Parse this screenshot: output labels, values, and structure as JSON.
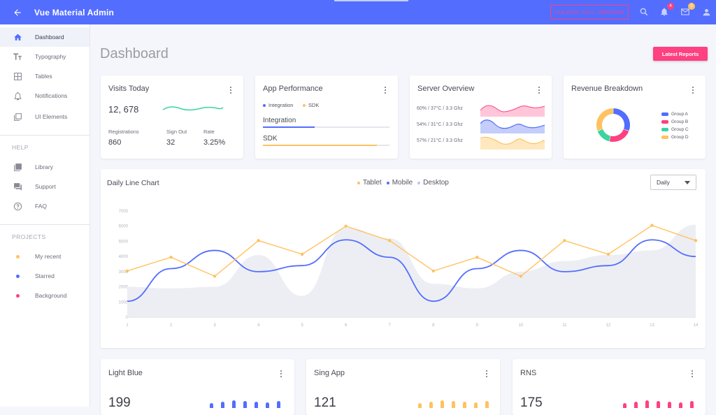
{
  "header": {
    "title": "Vue Material Admin",
    "unlock_label": "Unlock full version",
    "notifications_count": "4",
    "messages_count": "3"
  },
  "sidebar": {
    "items": [
      {
        "label": "Dashboard",
        "icon": "home-icon"
      },
      {
        "label": "Typography",
        "icon": "text-format-icon"
      },
      {
        "label": "Tables",
        "icon": "table-icon"
      },
      {
        "label": "Notifications",
        "icon": "bell-icon"
      },
      {
        "label": "UI Elements",
        "icon": "layers-icon"
      }
    ],
    "help_heading": "HELP",
    "help_items": [
      {
        "label": "Library",
        "icon": "library-icon"
      },
      {
        "label": "Support",
        "icon": "forum-icon"
      },
      {
        "label": "FAQ",
        "icon": "help-circle-icon"
      }
    ],
    "projects_heading": "PROJECTS",
    "projects": [
      {
        "label": "My recent",
        "color": "#ffc260"
      },
      {
        "label": "Starred",
        "color": "#536dfe"
      },
      {
        "label": "Background",
        "color": "#ff4081"
      }
    ]
  },
  "page": {
    "title": "Dashboard",
    "latest_reports_label": "Latest Reports"
  },
  "visits": {
    "title": "Visits Today",
    "value": "12, 678",
    "stats": [
      {
        "label": "Registrations",
        "value": "860"
      },
      {
        "label": "Sign Out",
        "value": "32"
      },
      {
        "label": "Rate",
        "value": "3.25%"
      }
    ]
  },
  "performance": {
    "title": "App Performance",
    "legend": [
      {
        "label": "Integration",
        "color": "#536dfe"
      },
      {
        "label": "SDK",
        "color": "#ffc260"
      }
    ],
    "bars": [
      {
        "label": "Integration",
        "value": 0.41,
        "color": "#536dfe"
      },
      {
        "label": "SDK",
        "value": 0.9,
        "color": "#ffc260"
      }
    ]
  },
  "server": {
    "title": "Server Overview",
    "rows": [
      {
        "label": "60% / 37°C / 3.3 Ghz",
        "color": "#ff4081"
      },
      {
        "label": "54% / 31°C / 3.3 Ghz",
        "color": "#536dfe"
      },
      {
        "label": "57% / 21°C / 3.3 Ghz",
        "color": "#ffc260"
      }
    ]
  },
  "revenue": {
    "title": "Revenue Breakdown",
    "groups": [
      {
        "label": "Group A",
        "color": "#536dfe",
        "value": 400
      },
      {
        "label": "Group B",
        "color": "#ff4081",
        "value": 300
      },
      {
        "label": "Group C",
        "color": "#3cd4a0",
        "value": 200
      },
      {
        "label": "Group D",
        "color": "#ffc260",
        "value": 400
      }
    ]
  },
  "daily_chart": {
    "title": "Daily Line Chart",
    "select_value": "Daily",
    "legend": [
      {
        "label": "Tablet",
        "color": "#ffc260"
      },
      {
        "label": "Mobile",
        "color": "#536dfe"
      },
      {
        "label": "Desktop",
        "color": "#b7c4ff"
      }
    ]
  },
  "chart_data": {
    "type": "line",
    "title": "Daily Line Chart",
    "x": [
      1,
      2,
      3,
      4,
      5,
      6,
      7,
      8,
      9,
      10,
      11,
      12,
      13,
      14
    ],
    "ylim": [
      0,
      7000
    ],
    "yticks": [
      "7000",
      "6000",
      "5000",
      "4000",
      "3000",
      "2000",
      "1000",
      "0"
    ],
    "xticks": [
      "1",
      "2",
      "3",
      "4",
      "5",
      "6",
      "7",
      "8",
      "9",
      "10",
      "11",
      "12",
      "13",
      "14"
    ],
    "series": [
      {
        "name": "Tablet",
        "color": "#ffc260",
        "values": [
          3050,
          3950,
          2700,
          5050,
          4150,
          6000,
          5050,
          3050,
          3950,
          2700,
          5050,
          4150,
          6050,
          5050
        ]
      },
      {
        "name": "Mobile",
        "color": "#536dfe",
        "values": [
          1050,
          3200,
          4400,
          3000,
          3400,
          5100,
          3950,
          1050,
          3200,
          4400,
          3000,
          3400,
          5100,
          4000
        ]
      },
      {
        "name": "Desktop",
        "color": "#eceef3",
        "values": [
          2000,
          1900,
          2000,
          4100,
          1400,
          5900,
          5200,
          2200,
          1900,
          3000,
          3700,
          4100,
          4400,
          6100
        ]
      }
    ],
    "grid": false,
    "legend": "top-center"
  },
  "bottom_cards": [
    {
      "title": "Light Blue",
      "value": "199",
      "color": "#536dfe"
    },
    {
      "title": "Sing App",
      "value": "121",
      "color": "#ffc260"
    },
    {
      "title": "RNS",
      "value": "175",
      "color": "#ff4081"
    }
  ]
}
